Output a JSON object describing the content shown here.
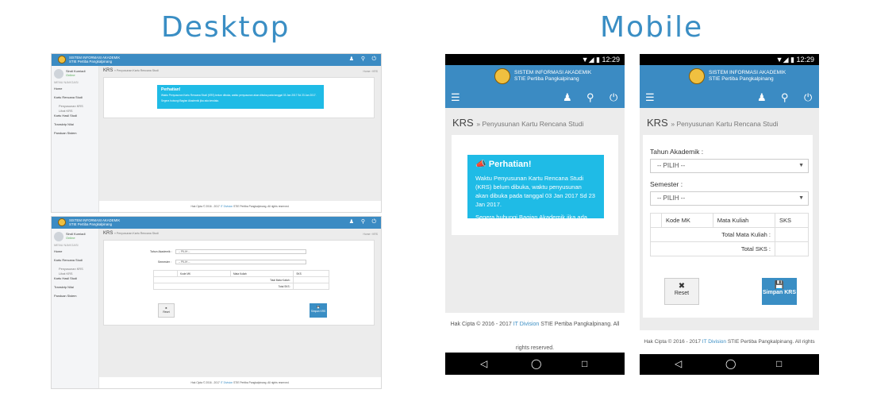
{
  "headings": {
    "desktop": "Desktop",
    "mobile": "Mobile"
  },
  "app": {
    "title": "SISTEM INFORMASI AKADEMIK",
    "subtitle": "STIE Pertiba Pangkalpinang"
  },
  "user": {
    "name": "Sindi Kumiadi",
    "status": "Online"
  },
  "sidebar": {
    "caption": "MENU NAVIGASI",
    "items": [
      "Home",
      "Kartu Rencana Studi",
      "Penyusunan KRS",
      "Lihat KRS",
      "Kartu Hasil Studi",
      "Transkrip Nilai",
      "Panduan Sistem"
    ]
  },
  "page": {
    "title": "KRS",
    "subtitle": "» Penyusunan Kartu Rencana Studi",
    "crumb_home": "Home",
    "crumb_current": "KRS"
  },
  "alert": {
    "title": "Perhatian!",
    "body": "Waktu Penyusunan Kartu Rencana Studi (KRS) belum dibuka, waktu penyusunan akan dibuka pada tanggal 03 Jan 2017 Sd 23 Jan 2017.",
    "contact": "Segera hubungi Bagian Akademik jika ada kendala."
  },
  "form": {
    "tahun_label": "Tahun Akademik :",
    "semester_label": "Semester :",
    "select_placeholder": "-- PILIH --",
    "col_kode": "Kode MK",
    "col_mata": "Mata Kuliah",
    "col_sks": "SKS",
    "total_mata": "Total Mata Kuliah :",
    "total_sks": "Total SKS :",
    "reset_label": "Reset",
    "save_label": "Simpan KRS"
  },
  "footer": {
    "prefix": "Hak Cipta © 2016 - 2017",
    "link": "IT Division",
    "suffix": "STIE Pertiba Pangkalpinang. All rights reserved."
  },
  "phone": {
    "time": "12:29"
  },
  "icons": {
    "bars": "bars-icon",
    "user": "user-icon",
    "key": "key-icon",
    "power": "power-icon",
    "back": "back-icon",
    "home": "home-icon",
    "recent": "recent-icon"
  },
  "colors": {
    "primary": "#3b8bc3",
    "alert": "#1fbbe6",
    "heading": "#3a8ec4"
  }
}
